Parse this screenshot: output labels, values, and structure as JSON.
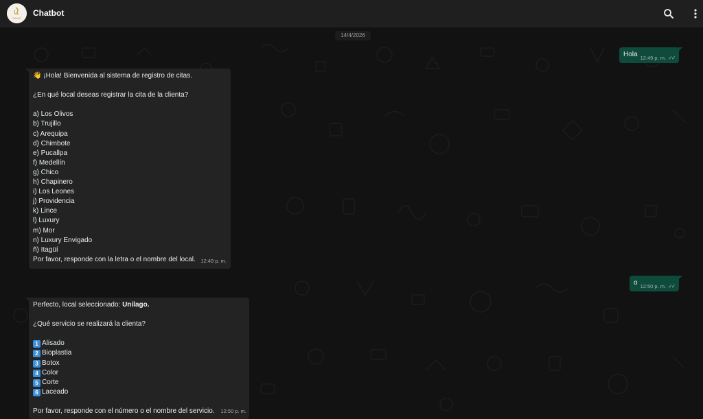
{
  "header": {
    "title": "Chatbot",
    "avatar_text": "BRAND",
    "search_icon": "search-icon",
    "menu_icon": "more-vertical-icon"
  },
  "chat": {
    "date": "14/4/2026",
    "messages": [
      {
        "direction": "out",
        "text": "Hola",
        "time": "12:49 p. m.",
        "status": "read-ticks"
      },
      {
        "direction": "in",
        "time": "12:49 p. m.",
        "emoji": "👋",
        "lines": [
          "¡Hola! Bienvenida al sistema de registro de citas.",
          "",
          "¿En qué local deseas registrar la cita de la clienta?",
          "",
          "a) Los Olivos",
          "b) Trujillo",
          "c) Arequipa",
          "d) Chimbote",
          "e) Pucallpa",
          "f) Medellín",
          "g) Chico",
          "h) Chapinero",
          "i) Los Leones",
          "j) Providencia",
          "k) Lince",
          "l) Luxury",
          "m) Mor",
          "n) Luxury Envigado",
          "ñ) Itagüí",
          "Por favor, responde con la letra o el nombre del local."
        ]
      },
      {
        "direction": "out",
        "text": "o",
        "time": "12:50 p. m.",
        "status": "read-ticks"
      },
      {
        "direction": "in",
        "time": "12:50 p. m.",
        "intro": "Perfecto, local seleccionado: ",
        "intro_bold": "Unilago.",
        "question": "¿Qué servicio se realizará la clienta?",
        "services": [
          {
            "num": "1",
            "label": "Alisado"
          },
          {
            "num": "2",
            "label": "Bioplastia"
          },
          {
            "num": "3",
            "label": "Botox"
          },
          {
            "num": "4",
            "label": "Color"
          },
          {
            "num": "5",
            "label": "Corte"
          },
          {
            "num": "6",
            "label": "Laceado"
          }
        ],
        "footer": "Por favor, responde con el número o el nombre del servicio."
      }
    ]
  },
  "colors": {
    "header_bg": "#1f1f1f",
    "chat_bg": "#121212",
    "incoming_bubble": "#232323",
    "outgoing_bubble": "#0f4b3a",
    "keycap_blue": "#3b8fd6"
  }
}
